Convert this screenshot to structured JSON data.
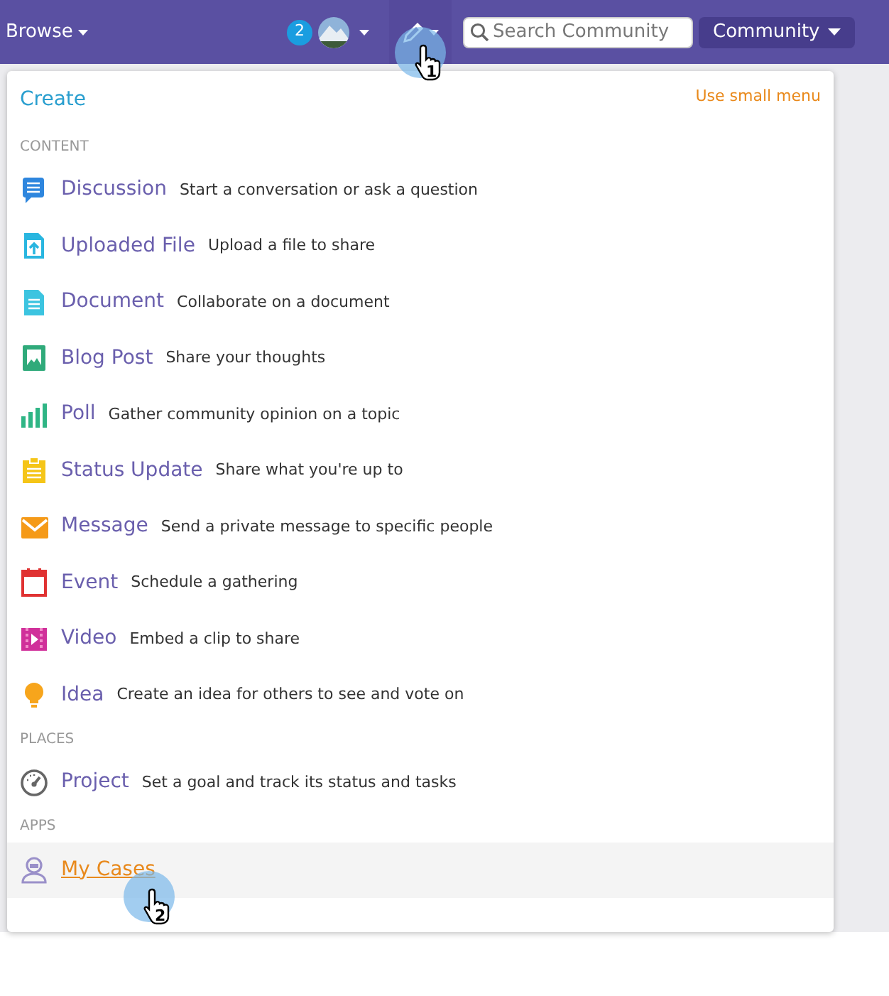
{
  "navbar": {
    "browse": {
      "label": "Browse"
    },
    "notifications": {
      "count": "2"
    },
    "create_button": {
      "cursor_step": "1"
    },
    "search": {
      "placeholder": "Search Community"
    },
    "scope_button": {
      "label": "Community"
    }
  },
  "create_menu": {
    "title": "Create",
    "small_menu_link": "Use small menu",
    "sections": [
      {
        "heading": "CONTENT",
        "items": [
          {
            "kind": "discussion",
            "title": "Discussion",
            "description": "Start a conversation or ask a question",
            "hovered": false
          },
          {
            "kind": "upload",
            "title": "Uploaded File",
            "description": "Upload a file to share",
            "hovered": false
          },
          {
            "kind": "document",
            "title": "Document",
            "description": "Collaborate on a document",
            "hovered": false
          },
          {
            "kind": "blog",
            "title": "Blog Post",
            "description": "Share your thoughts",
            "hovered": false
          },
          {
            "kind": "poll",
            "title": "Poll",
            "description": "Gather community opinion on a topic",
            "hovered": false
          },
          {
            "kind": "status",
            "title": "Status Update",
            "description": "Share what you're up to",
            "hovered": false
          },
          {
            "kind": "message",
            "title": "Message",
            "description": "Send a private message to specific people",
            "hovered": false
          },
          {
            "kind": "event",
            "title": "Event",
            "description": "Schedule a gathering",
            "hovered": false
          },
          {
            "kind": "video",
            "title": "Video",
            "description": "Embed a clip to share",
            "hovered": false
          },
          {
            "kind": "idea",
            "title": "Idea",
            "description": "Create an idea for others to see and vote on",
            "hovered": false
          }
        ]
      },
      {
        "heading": "PLACES",
        "items": [
          {
            "kind": "project",
            "title": "Project",
            "description": "Set a goal and track its status and tasks",
            "hovered": false
          }
        ]
      },
      {
        "heading": "APPS",
        "items": [
          {
            "kind": "agent",
            "title": "My Cases",
            "hovered": true,
            "cursor_step": "2"
          }
        ]
      }
    ]
  }
}
